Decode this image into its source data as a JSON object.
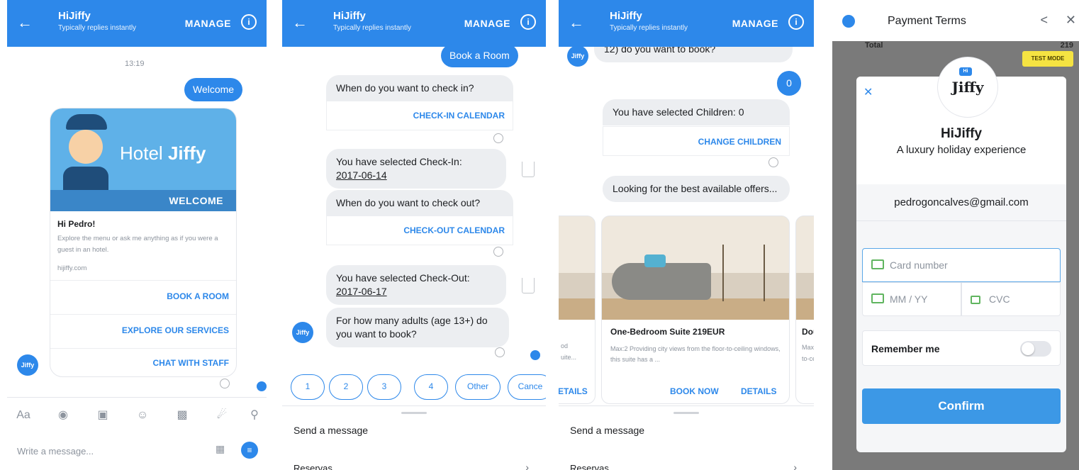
{
  "header": {
    "name": "HiJiffy",
    "subtitle": "Typically replies instantly",
    "manage": "MANAGE",
    "info_icon": "info-icon",
    "back_icon": "back-arrow-icon"
  },
  "screen1": {
    "timestamp": "13:19",
    "welcome_bubble": "Welcome",
    "hero_text_prefix": "Hotel",
    "hero_text_bold": "Jiffy",
    "hero_banner": "WELCOME",
    "card_title": "Hi Pedro!",
    "card_desc": "Explore the menu or ask me anything as if you were a guest in an hotel.",
    "card_domain": "hijiffy.com",
    "actions": [
      "BOOK A ROOM",
      "EXPLORE OUR SERVICES",
      "CHAT WITH STAFF"
    ],
    "composer_placeholder": "Write a message...",
    "icons": [
      "aa-icon",
      "camera-icon",
      "gallery-icon",
      "emoji-icon",
      "gif-icon",
      "microphone-icon",
      "location-icon"
    ]
  },
  "screen2": {
    "book_room": "Book a Room",
    "q_checkin": "When do you want to check in?",
    "checkin_calendar": "CHECK-IN CALENDAR",
    "selected_checkin_label": "You have selected Check-In:",
    "selected_checkin_date": "2017-06-14",
    "q_checkout": "When do you want to check out?",
    "checkout_calendar": "CHECK-OUT CALENDAR",
    "selected_checkout_label": "You have selected Check-Out:",
    "selected_checkout_date": "2017-06-17",
    "q_adults": "For how many adults (age 13+) do you want to book?",
    "quick_replies": [
      "1",
      "2",
      "3",
      "4",
      "Other",
      "Cance"
    ],
    "send_message": "Send a message",
    "reservas": "Reservas"
  },
  "screen3": {
    "prev_text": "12) do you want to book?",
    "reply_zero": "0",
    "selected_children": "You have selected Children: 0",
    "change_children": "CHANGE CHILDREN",
    "looking_offers": "Looking for the best available offers...",
    "room_title": "One-Bedroom Suite 219EUR",
    "room_desc": "Max:2 Providing city views from the floor-to-ceiling windows, this suite has a ...",
    "book_now": "BOOK NOW",
    "details": "DETAILS",
    "left_partial_line1": "od",
    "left_partial_line2": "uite...",
    "left_partial_button": "ETAILS",
    "right_partial_title": "Dou",
    "right_partial_line1": "Max",
    "right_partial_line2": "to-ce",
    "send_message": "Send a message",
    "reservas": "Reservas"
  },
  "screen4": {
    "title": "Payment Terms",
    "total_label": "Total",
    "total_amount": "219",
    "test_mode": "TEST MODE",
    "brand_mini": "Hi",
    "brand_word": "Jiffy",
    "merchant_name": "HiJiffy",
    "merchant_tagline": "A luxury holiday experience",
    "email": "pedrogoncalves@gmail.com",
    "card_placeholder": "Card number",
    "expiry_placeholder": "MM / YY",
    "cvc_placeholder": "CVC",
    "remember_label": "Remember me",
    "confirm_label": "Confirm"
  }
}
